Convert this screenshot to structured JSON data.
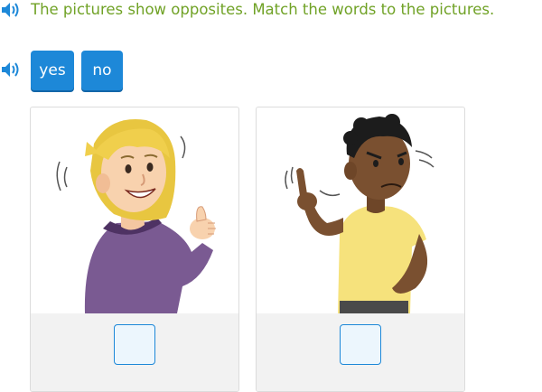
{
  "instruction": {
    "text": "The pictures show opposites. Match the words to the pictures.",
    "speaker_icon": "speaker-icon",
    "color": "#70a226"
  },
  "word_bank": {
    "speaker_icon": "speaker-icon",
    "tiles": [
      {
        "label": "yes"
      },
      {
        "label": "no"
      }
    ],
    "tile_color": "#1d88d8"
  },
  "cards": [
    {
      "picture": "girl-thumbs-up-nodding",
      "answer": ""
    },
    {
      "picture": "boy-finger-wag-shaking-head",
      "answer": ""
    }
  ]
}
